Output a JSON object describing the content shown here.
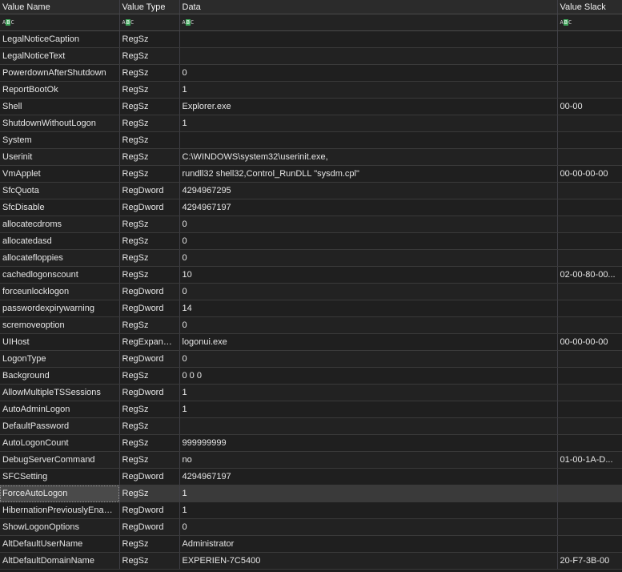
{
  "columns": {
    "value_name": "Value Name",
    "value_type": "Value Type",
    "data": "Data",
    "value_slack": "Value Slack"
  },
  "filter_icon": {
    "a": "A",
    "b": "B",
    "c": "C",
    "icon": "text-filter-icon"
  },
  "colors": {
    "background": "#1e1e1e",
    "selected_row": "#3a3a3a",
    "filter_icon_accent": "#3ea65a"
  },
  "rows": [
    {
      "name": "LegalNoticeCaption",
      "type": "RegSz",
      "data": "",
      "slack": ""
    },
    {
      "name": "LegalNoticeText",
      "type": "RegSz",
      "data": "",
      "slack": ""
    },
    {
      "name": "PowerdownAfterShutdown",
      "type": "RegSz",
      "data": "0",
      "slack": ""
    },
    {
      "name": "ReportBootOk",
      "type": "RegSz",
      "data": "1",
      "slack": ""
    },
    {
      "name": "Shell",
      "type": "RegSz",
      "data": "Explorer.exe",
      "slack": "00-00"
    },
    {
      "name": "ShutdownWithoutLogon",
      "type": "RegSz",
      "data": "1",
      "slack": ""
    },
    {
      "name": "System",
      "type": "RegSz",
      "data": "",
      "slack": ""
    },
    {
      "name": "Userinit",
      "type": "RegSz",
      "data": "C:\\WINDOWS\\system32\\userinit.exe,",
      "slack": ""
    },
    {
      "name": "VmApplet",
      "type": "RegSz",
      "data": "rundll32 shell32,Control_RunDLL \"sysdm.cpl\"",
      "slack": "00-00-00-00"
    },
    {
      "name": "SfcQuota",
      "type": "RegDword",
      "data": "4294967295",
      "slack": ""
    },
    {
      "name": "SfcDisable",
      "type": "RegDword",
      "data": "4294967197",
      "slack": ""
    },
    {
      "name": "allocatecdroms",
      "type": "RegSz",
      "data": "0",
      "slack": ""
    },
    {
      "name": "allocatedasd",
      "type": "RegSz",
      "data": "0",
      "slack": ""
    },
    {
      "name": "allocatefloppies",
      "type": "RegSz",
      "data": "0",
      "slack": ""
    },
    {
      "name": "cachedlogonscount",
      "type": "RegSz",
      "data": "10",
      "slack": "02-00-80-00..."
    },
    {
      "name": "forceunlocklogon",
      "type": "RegDword",
      "data": "0",
      "slack": ""
    },
    {
      "name": "passwordexpirywarning",
      "type": "RegDword",
      "data": "14",
      "slack": ""
    },
    {
      "name": "scremoveoption",
      "type": "RegSz",
      "data": "0",
      "slack": ""
    },
    {
      "name": "UIHost",
      "type": "RegExpandSz",
      "data": "logonui.exe",
      "slack": "00-00-00-00"
    },
    {
      "name": "LogonType",
      "type": "RegDword",
      "data": "0",
      "slack": ""
    },
    {
      "name": "Background",
      "type": "RegSz",
      "data": "0 0 0",
      "slack": ""
    },
    {
      "name": "AllowMultipleTSSessions",
      "type": "RegDword",
      "data": "1",
      "slack": ""
    },
    {
      "name": "AutoAdminLogon",
      "type": "RegSz",
      "data": "1",
      "slack": ""
    },
    {
      "name": "DefaultPassword",
      "type": "RegSz",
      "data": "",
      "slack": ""
    },
    {
      "name": "AutoLogonCount",
      "type": "RegSz",
      "data": "999999999",
      "slack": ""
    },
    {
      "name": "DebugServerCommand",
      "type": "RegSz",
      "data": "no",
      "slack": "01-00-1A-D..."
    },
    {
      "name": "SFCSetting",
      "type": "RegDword",
      "data": "4294967197",
      "slack": ""
    },
    {
      "name": "ForceAutoLogon",
      "type": "RegSz",
      "data": "1",
      "slack": "",
      "selected": true
    },
    {
      "name": "HibernationPreviouslyEnabled",
      "type": "RegDword",
      "data": "1",
      "slack": ""
    },
    {
      "name": "ShowLogonOptions",
      "type": "RegDword",
      "data": "0",
      "slack": ""
    },
    {
      "name": "AltDefaultUserName",
      "type": "RegSz",
      "data": "Administrator",
      "slack": ""
    },
    {
      "name": "AltDefaultDomainName",
      "type": "RegSz",
      "data": "EXPERIEN-7C5400",
      "slack": "20-F7-3B-00"
    }
  ]
}
